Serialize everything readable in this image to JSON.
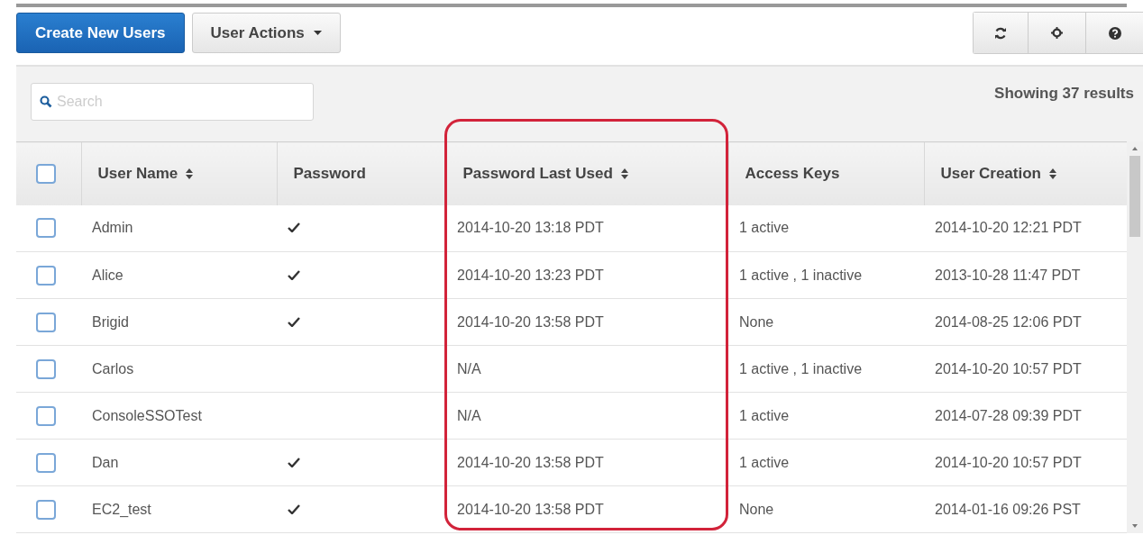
{
  "toolbar": {
    "create_button": "Create New Users",
    "actions_button": "User Actions"
  },
  "search": {
    "placeholder": "Search"
  },
  "results": "Showing 37 results",
  "table": {
    "header_checked": false,
    "columns": [
      {
        "label": "User Name",
        "sortable": true
      },
      {
        "label": "Password",
        "sortable": false
      },
      {
        "label": "Password Last Used",
        "sortable": true
      },
      {
        "label": "Access Keys",
        "sortable": false
      },
      {
        "label": "User Creation",
        "sortable": true
      }
    ],
    "rows": [
      {
        "checked": false,
        "user": "Admin",
        "password": true,
        "last_used": "2014-10-20 13:18 PDT",
        "access_keys": "1 active",
        "created": "2014-10-20 12:21 PDT"
      },
      {
        "checked": false,
        "user": "Alice",
        "password": true,
        "last_used": "2014-10-20 13:23 PDT",
        "access_keys": "1 active , 1 inactive",
        "created": "2013-10-28 11:47 PDT"
      },
      {
        "checked": false,
        "user": "Brigid",
        "password": true,
        "last_used": "2014-10-20 13:58 PDT",
        "access_keys": "None",
        "created": "2014-08-25 12:06 PDT"
      },
      {
        "checked": false,
        "user": "Carlos",
        "password": false,
        "last_used": "N/A",
        "access_keys": "1 active , 1 inactive",
        "created": "2014-10-20 10:57 PDT"
      },
      {
        "checked": false,
        "user": "ConsoleSSOTest",
        "password": false,
        "last_used": "N/A",
        "access_keys": "1 active",
        "created": "2014-07-28 09:39 PDT"
      },
      {
        "checked": false,
        "user": "Dan",
        "password": true,
        "last_used": "2014-10-20 13:58 PDT",
        "access_keys": "1 active",
        "created": "2014-10-20 10:57 PDT"
      },
      {
        "checked": false,
        "user": "EC2_test",
        "password": true,
        "last_used": "2014-10-20 13:58 PDT",
        "access_keys": "None",
        "created": "2014-01-16 09:26 PST"
      }
    ]
  }
}
